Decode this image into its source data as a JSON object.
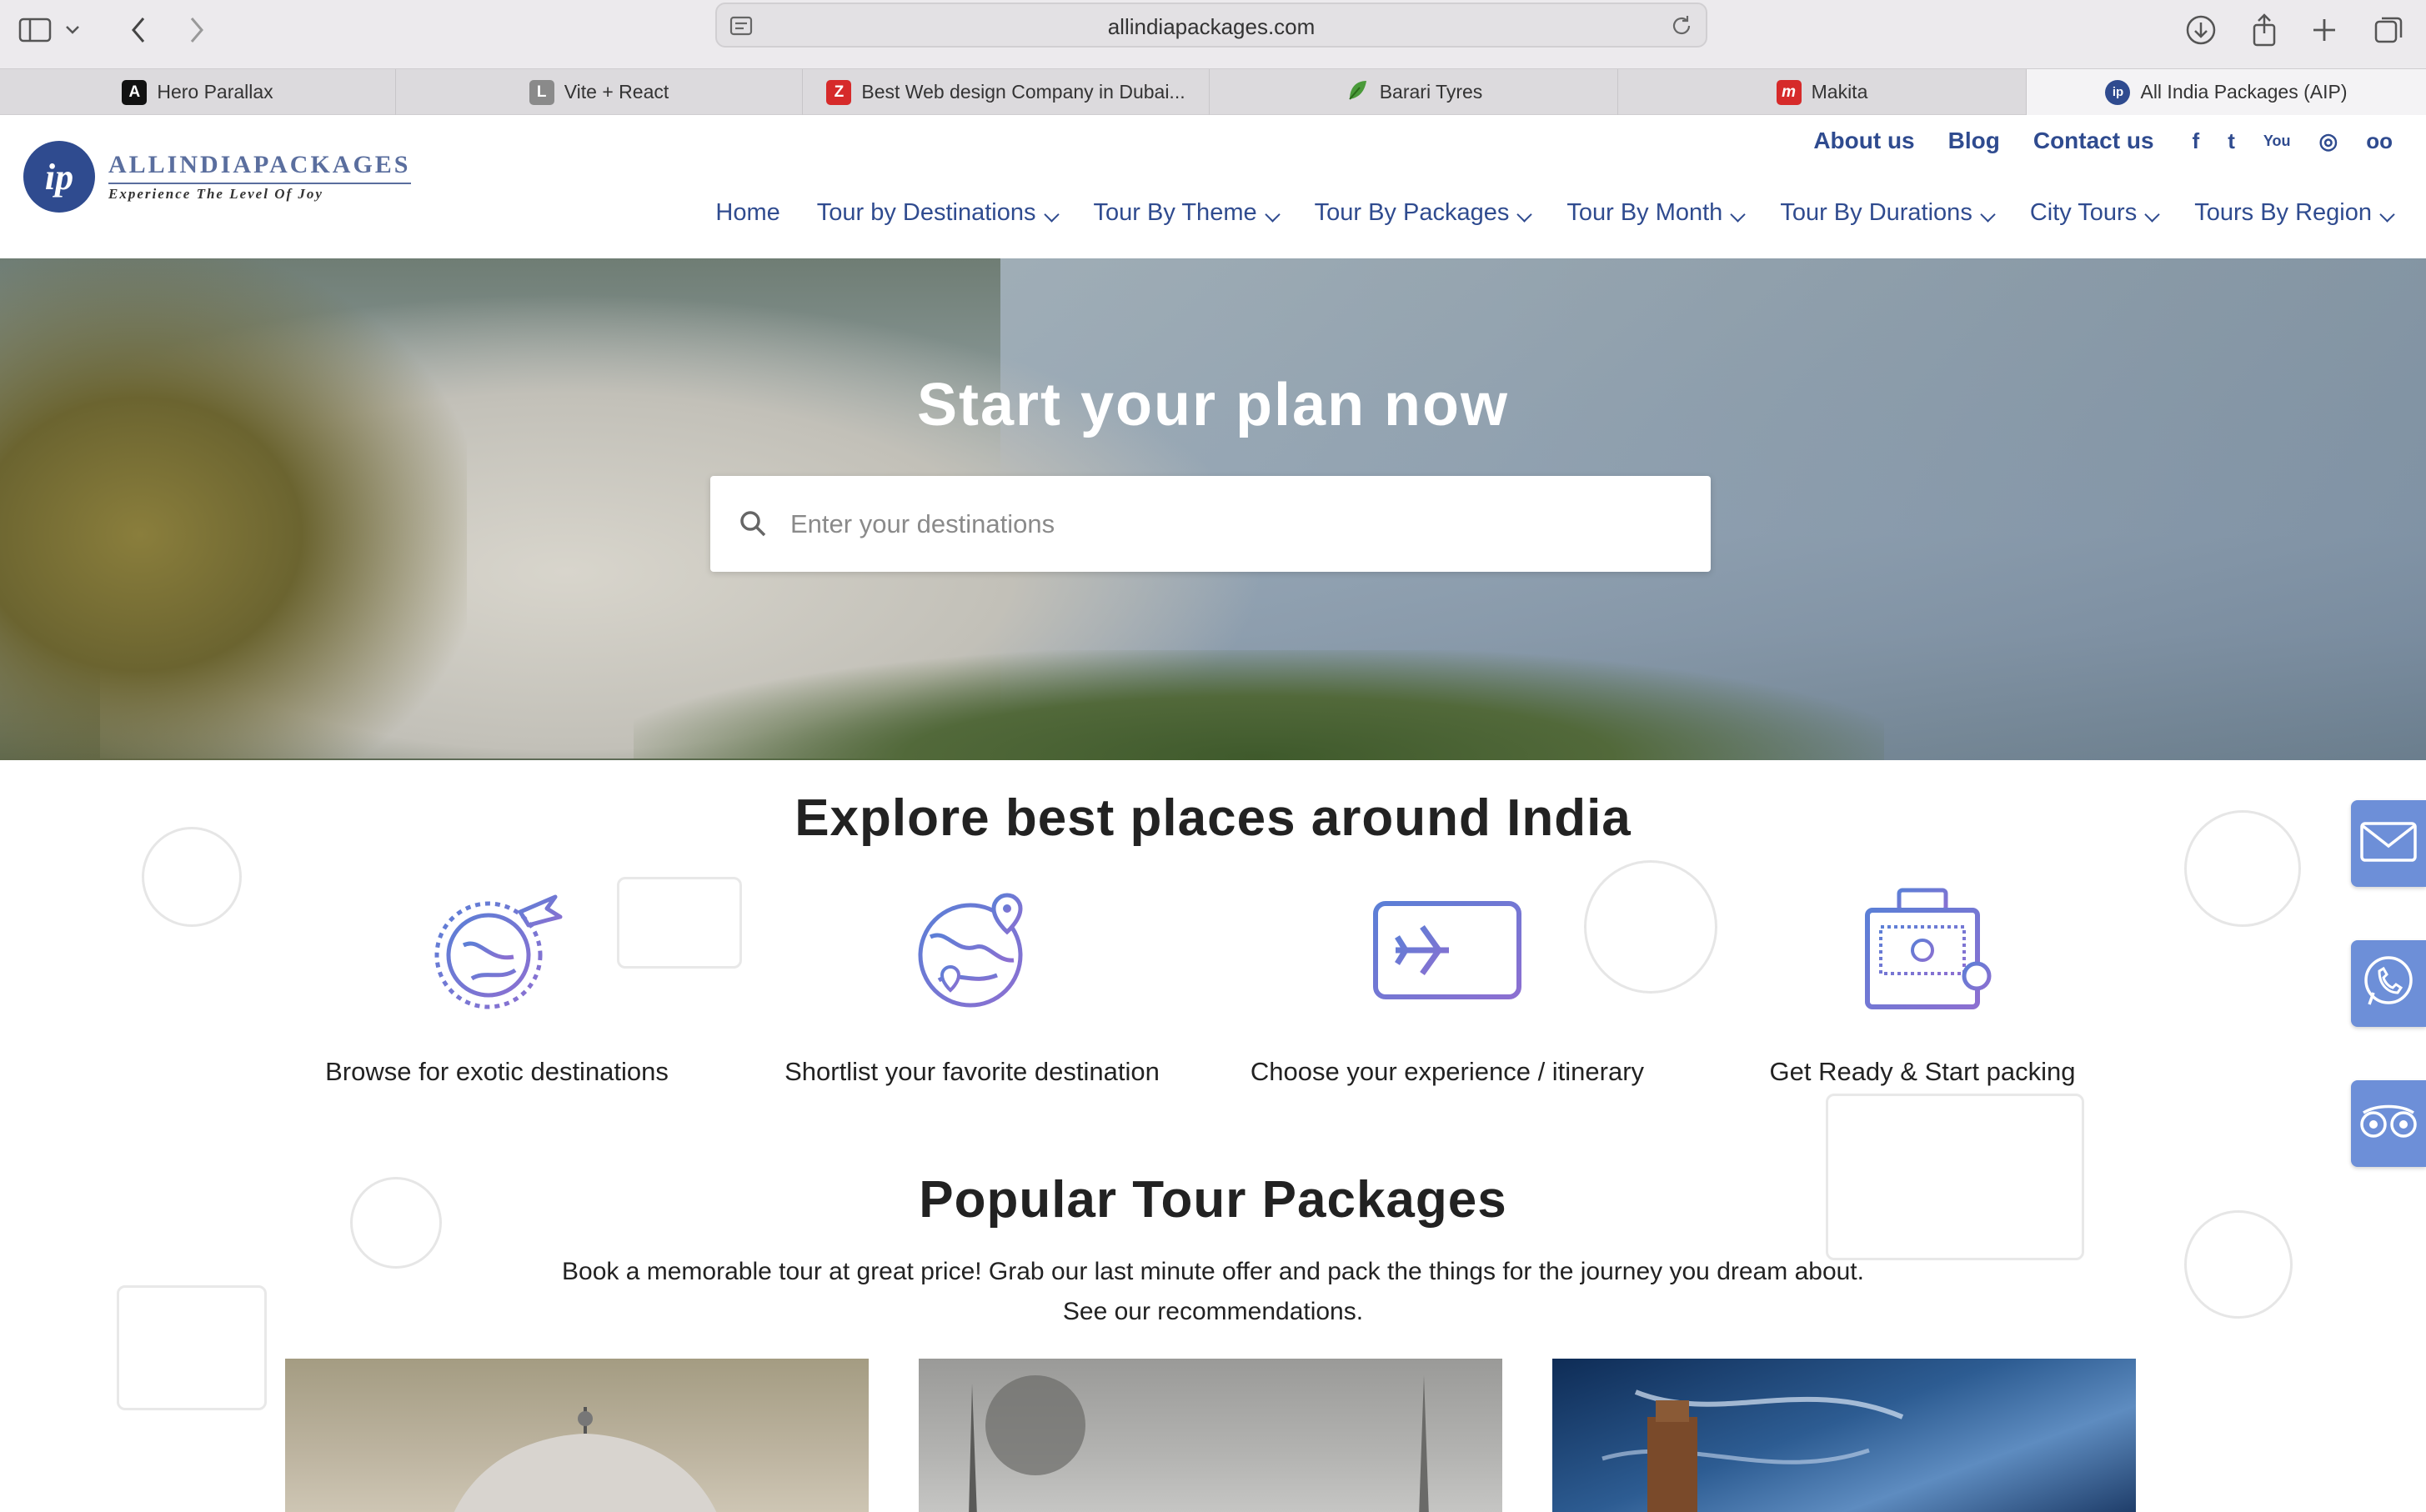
{
  "browser": {
    "url": "allindiapackages.com",
    "tabs": [
      {
        "label": "Hero Parallax",
        "favicon": "A",
        "favicon_color": "#111111"
      },
      {
        "label": "Vite + React",
        "favicon": "L",
        "favicon_color": "#8a8a8a"
      },
      {
        "label": "Best Web design Company in Dubai...",
        "favicon": "Z",
        "favicon_color": "#d62a2a"
      },
      {
        "label": "Barari Tyres",
        "favicon": "",
        "favicon_color": "#4a9a3a"
      },
      {
        "label": "Makita",
        "favicon": "m",
        "favicon_color": "#d62a2a"
      },
      {
        "label": "All India Packages (AIP)",
        "favicon": "ip",
        "favicon_color": "#2f4b8f"
      }
    ],
    "active_tab": 5
  },
  "header": {
    "logo_initials": "ip",
    "logo_name": "ALLINDIAPACKAGES",
    "logo_tagline": "Experience The Level Of Joy",
    "top_links": [
      "About us",
      "Blog",
      "Contact us"
    ],
    "social_icons": [
      "facebook-icon",
      "twitter-icon",
      "youtube-icon",
      "instagram-icon",
      "tripadvisor-icon"
    ],
    "social_glyphs": [
      "f",
      "t",
      "You",
      "◎",
      "oo"
    ],
    "nav": [
      {
        "label": "Home",
        "dropdown": false
      },
      {
        "label": "Tour by Destinations",
        "dropdown": true
      },
      {
        "label": "Tour By Theme",
        "dropdown": true
      },
      {
        "label": "Tour By Packages",
        "dropdown": true
      },
      {
        "label": "Tour By Month",
        "dropdown": true
      },
      {
        "label": "Tour By Durations",
        "dropdown": true
      },
      {
        "label": "City Tours",
        "dropdown": true
      },
      {
        "label": "Tours By Region",
        "dropdown": true
      }
    ],
    "brand_color": "#2f4b8f"
  },
  "hero": {
    "title": "Start your plan now",
    "search_placeholder": "Enter your destinations"
  },
  "explore": {
    "title": "Explore best places around India",
    "steps": [
      {
        "label": "Browse for exotic destinations",
        "icon": "globe-plane-icon"
      },
      {
        "label": "Shortlist your favorite destination",
        "icon": "globe-pin-icon"
      },
      {
        "label": "Choose your experience / itinerary",
        "icon": "flight-ticket-icon"
      },
      {
        "label": "Get Ready & Start packing",
        "icon": "suitcase-icon"
      }
    ]
  },
  "popular": {
    "title": "Popular Tour Packages",
    "subtitle_line1": "Book a memorable tour at great price! Grab our last minute offer and pack the things for the journey you dream about.",
    "subtitle_line2": "See our recommendations."
  },
  "side_buttons": [
    "mail-icon",
    "whatsapp-icon",
    "tripadvisor-icon"
  ],
  "side_color": "#6d8fd8"
}
